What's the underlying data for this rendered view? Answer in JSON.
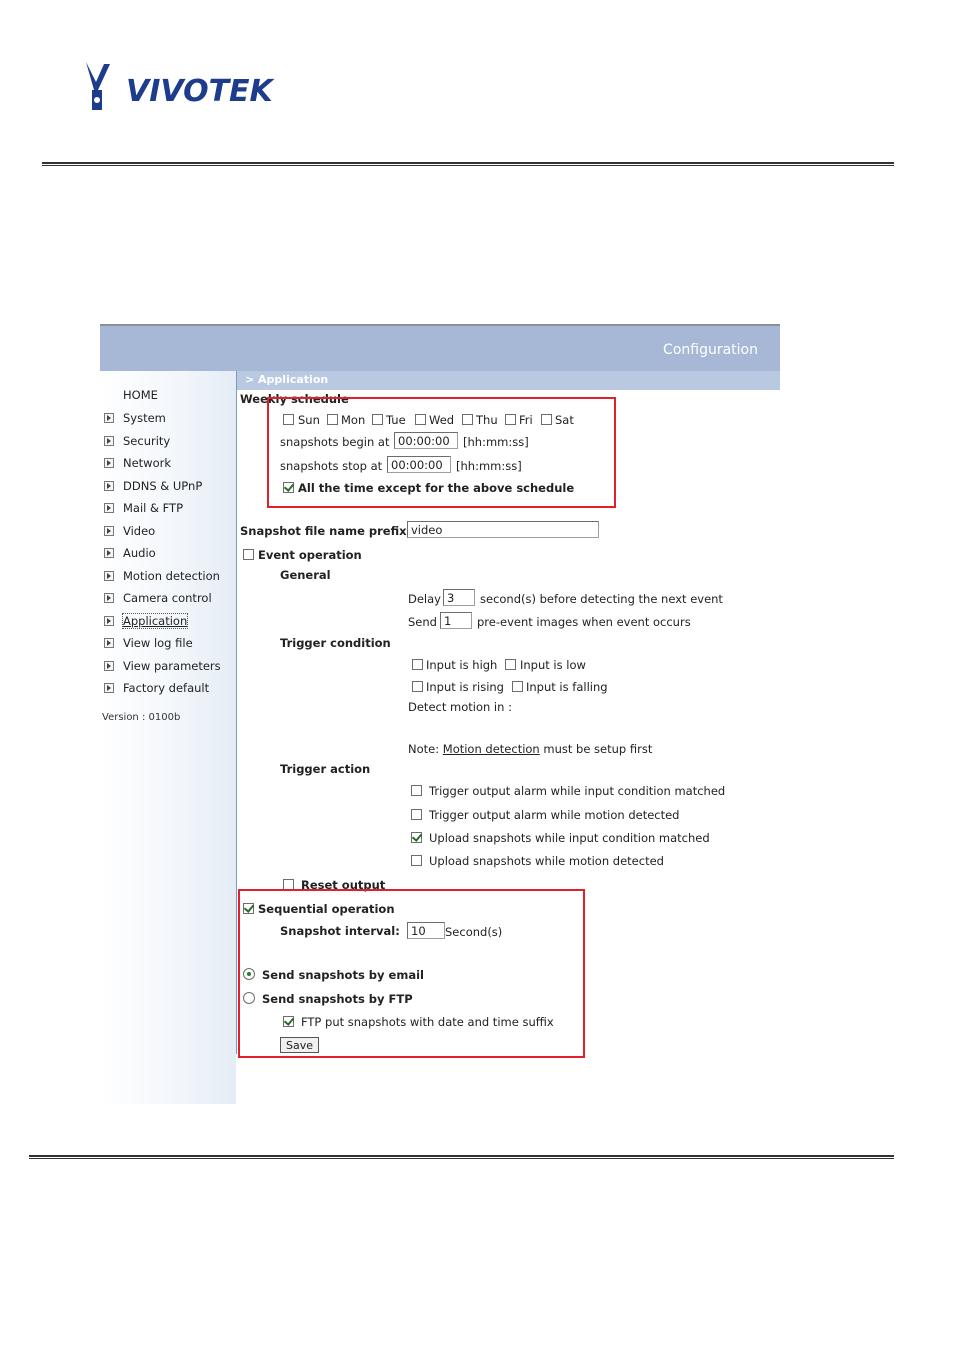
{
  "doc": {
    "logo_text": "VIVOTEK"
  },
  "header": {
    "title": "Configuration",
    "breadcrumb": "> Application"
  },
  "sidebar": {
    "home": "HOME",
    "items": [
      {
        "label": "System"
      },
      {
        "label": "Security"
      },
      {
        "label": "Network"
      },
      {
        "label": "DDNS & UPnP"
      },
      {
        "label": "Mail & FTP"
      },
      {
        "label": "Video"
      },
      {
        "label": "Audio"
      },
      {
        "label": "Motion detection"
      },
      {
        "label": "Camera control"
      },
      {
        "label": "Application"
      },
      {
        "label": "View log file"
      },
      {
        "label": "View parameters"
      },
      {
        "label": "Factory default"
      }
    ],
    "version": "Version : 0100b"
  },
  "weekly": {
    "title": "Weekly schedule",
    "days": [
      "Sun",
      "Mon",
      "Tue",
      "Wed",
      "Thu",
      "Fri",
      "Sat"
    ],
    "begin_label": "snapshots begin at",
    "begin_value": "00:00:00",
    "stop_label": "snapshots stop at",
    "stop_value": "00:00:00",
    "format_hint": "[hh:mm:ss]",
    "all_time_label": "All the time except for the above schedule"
  },
  "prefix": {
    "label": "Snapshot file name prefix",
    "value": "video"
  },
  "event": {
    "label": "Event operation",
    "general": "General",
    "delay_label": "Delay",
    "delay_value": "3",
    "delay_suffix": "second(s) before detecting the next event",
    "send_label": "Send",
    "send_value": "1",
    "send_suffix": "pre-event images when event occurs",
    "trigger_condition": "Trigger condition",
    "input_high": "Input is high",
    "input_low": "Input is low",
    "input_rising": "Input is rising",
    "input_falling": "Input is falling",
    "detect_motion": "Detect motion in :",
    "note_prefix": "Note:",
    "note_link": "Motion detection",
    "note_suffix": "must be setup first",
    "trigger_action": "Trigger action",
    "actions": [
      "Trigger output alarm while input condition matched",
      "Trigger output alarm while motion detected",
      "Upload snapshots while input condition matched",
      "Upload snapshots while motion detected"
    ],
    "reset_output": "Reset output"
  },
  "sequential": {
    "label": "Sequential operation",
    "interval_label": "Snapshot interval:",
    "interval_value": "10",
    "interval_unit": "Second(s)",
    "send_email": "Send snapshots by email",
    "send_ftp": "Send snapshots by FTP",
    "ftp_suffix": "FTP put snapshots with date and time suffix",
    "save": "Save"
  }
}
